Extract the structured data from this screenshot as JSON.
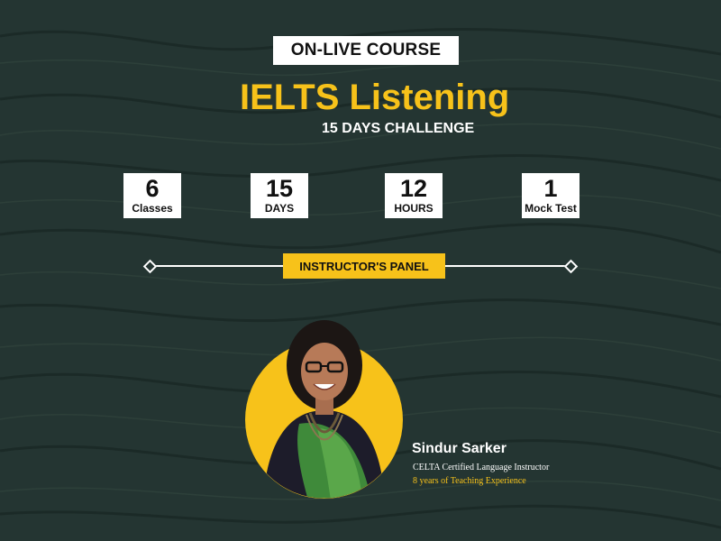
{
  "badge": "ON-LIVE COURSE",
  "title": "IELTS Listening",
  "subtitle": "15 DAYS CHALLENGE",
  "stats": [
    {
      "number": "6",
      "unit": "Classes"
    },
    {
      "number": "15",
      "unit": "DAYS"
    },
    {
      "number": "12",
      "unit": "HOURS"
    },
    {
      "number": "1",
      "unit": "Mock Test"
    }
  ],
  "panel_label": "INSTRUCTOR'S PANEL",
  "instructor": {
    "name": "Sindur Sarker",
    "role": "CELTA Certified Language Instructor",
    "experience": "8 years of Teaching Experience"
  },
  "colors": {
    "background": "#243532",
    "accent": "#f7c21a",
    "text": "#ffffff"
  }
}
